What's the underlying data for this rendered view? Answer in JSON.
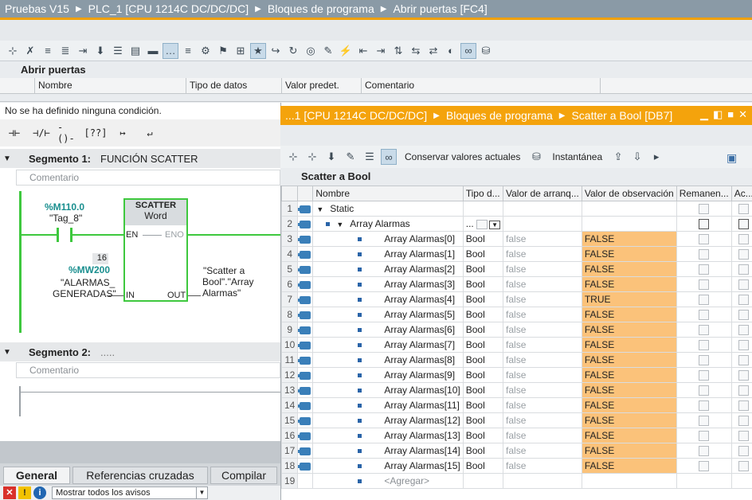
{
  "breadcrumb": [
    "Pruebas V15",
    "PLC_1 [CPU 1214C DC/DC/DC]",
    "Bloques de programa",
    "Abrir puertas [FC4]"
  ],
  "block_interface": {
    "title": "Abrir puertas",
    "columns": [
      "Nombre",
      "Tipo de datos",
      "Valor predet.",
      "Comentario"
    ]
  },
  "editor": {
    "no_condition": "No se ha definido ninguna condición.",
    "segment1": {
      "label": "Segmento 1:",
      "title": "FUNCIÓN SCATTER",
      "comment": "Comentario",
      "contact_address": "%M110.0",
      "contact_tag": "\"Tag_8\"",
      "box_title": "SCATTER",
      "box_type": "Word",
      "en": "EN",
      "eno": "ENO",
      "in": "IN",
      "out": "OUT",
      "in_value": "16",
      "in_address": "%MW200",
      "in_tag_line1": "\"ALARMAS_",
      "in_tag_line2": "GENERADAS\"",
      "out_line1": "\"Scatter a",
      "out_line2": "Bool\".\"Array",
      "out_line3": "Alarmas\""
    },
    "segment2": {
      "label": "Segmento 2:",
      "title": ".....",
      "comment": "Comentario"
    }
  },
  "inspector": {
    "tabs": [
      "General",
      "Referencias cruzadas",
      "Compilar"
    ],
    "filter": "Mostrar todos los avisos"
  },
  "db_window": {
    "breadcrumb": [
      "...1 [CPU 1214C DC/DC/DC]",
      "Bloques de programa",
      "Scatter a Bool [DB7]"
    ],
    "toolbar_keep": "Conservar valores actuales",
    "toolbar_snapshot": "Instantánea",
    "name": "Scatter a Bool",
    "columns": [
      "Nombre",
      "Tipo d...",
      "Valor de arranq...",
      "Valor de observación",
      "Remanen...",
      "Ac..."
    ],
    "rows": [
      {
        "n": "1",
        "name": "Static",
        "type": "",
        "start": "",
        "obs": ""
      },
      {
        "n": "2",
        "name": "Array Alarmas",
        "type": "...",
        "start": "",
        "obs": ""
      },
      {
        "n": "3",
        "name": "Array Alarmas[0]",
        "type": "Bool",
        "start": "false",
        "obs": "FALSE"
      },
      {
        "n": "4",
        "name": "Array Alarmas[1]",
        "type": "Bool",
        "start": "false",
        "obs": "FALSE"
      },
      {
        "n": "5",
        "name": "Array Alarmas[2]",
        "type": "Bool",
        "start": "false",
        "obs": "FALSE"
      },
      {
        "n": "6",
        "name": "Array Alarmas[3]",
        "type": "Bool",
        "start": "false",
        "obs": "FALSE"
      },
      {
        "n": "7",
        "name": "Array Alarmas[4]",
        "type": "Bool",
        "start": "false",
        "obs": "TRUE"
      },
      {
        "n": "8",
        "name": "Array Alarmas[5]",
        "type": "Bool",
        "start": "false",
        "obs": "FALSE"
      },
      {
        "n": "9",
        "name": "Array Alarmas[6]",
        "type": "Bool",
        "start": "false",
        "obs": "FALSE"
      },
      {
        "n": "10",
        "name": "Array Alarmas[7]",
        "type": "Bool",
        "start": "false",
        "obs": "FALSE"
      },
      {
        "n": "11",
        "name": "Array Alarmas[8]",
        "type": "Bool",
        "start": "false",
        "obs": "FALSE"
      },
      {
        "n": "12",
        "name": "Array Alarmas[9]",
        "type": "Bool",
        "start": "false",
        "obs": "FALSE"
      },
      {
        "n": "13",
        "name": "Array Alarmas[10]",
        "type": "Bool",
        "start": "false",
        "obs": "FALSE"
      },
      {
        "n": "14",
        "name": "Array Alarmas[11]",
        "type": "Bool",
        "start": "false",
        "obs": "FALSE"
      },
      {
        "n": "15",
        "name": "Array Alarmas[12]",
        "type": "Bool",
        "start": "false",
        "obs": "FALSE"
      },
      {
        "n": "16",
        "name": "Array Alarmas[13]",
        "type": "Bool",
        "start": "false",
        "obs": "FALSE"
      },
      {
        "n": "17",
        "name": "Array Alarmas[14]",
        "type": "Bool",
        "start": "false",
        "obs": "FALSE"
      },
      {
        "n": "18",
        "name": "Array Alarmas[15]",
        "type": "Bool",
        "start": "false",
        "obs": "FALSE"
      },
      {
        "n": "19",
        "name": "<Agregar>",
        "type": "",
        "start": "",
        "obs": ""
      }
    ]
  },
  "colors": {
    "title_bar": "#8a9aa6",
    "accent_orange": "#f4a30c",
    "observe_highlight": "#fbc27a",
    "power_rail": "#3ec83e"
  }
}
